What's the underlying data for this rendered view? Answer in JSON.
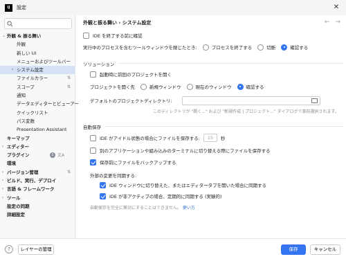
{
  "window": {
    "app_icon_text": "IJ",
    "title": "設定",
    "close_symbol": "✕"
  },
  "sidebar": {
    "search_placeholder": "",
    "items": [
      {
        "label": "外観 & 振る舞い",
        "arrow": "⌄",
        "bold": true
      },
      {
        "label": "外観"
      },
      {
        "label": "新しい UI"
      },
      {
        "label": "メニューおよびツールバー"
      },
      {
        "label": "システム設定",
        "arrow": "›",
        "selected": true
      },
      {
        "label": "ファイルカラー",
        "sync": "⇅"
      },
      {
        "label": "スコープ",
        "sync": "⇅"
      },
      {
        "label": "通知"
      },
      {
        "label": "データエディターとビューアー"
      },
      {
        "label": "クイックリスト"
      },
      {
        "label": "パス変数"
      },
      {
        "label": "Presentation Assistant"
      },
      {
        "label": "キーマップ",
        "bold": true
      },
      {
        "label": "エディター",
        "arrow": "›",
        "bold": true
      },
      {
        "label": "プラグイン",
        "bold": true,
        "badge": "2",
        "trans": "文A"
      },
      {
        "label": "環境",
        "bold": true
      },
      {
        "label": "バージョン管理",
        "arrow": "›",
        "bold": true,
        "sync": "⇅"
      },
      {
        "label": "ビルド、実行、デプロイ",
        "arrow": "›",
        "bold": true
      },
      {
        "label": "言語 & フレームワーク",
        "arrow": "›",
        "bold": true
      },
      {
        "label": "ツール",
        "arrow": "›",
        "bold": true
      },
      {
        "label": "設定の同期",
        "bold": true
      },
      {
        "label": "詳細設定",
        "bold": true
      }
    ]
  },
  "header": {
    "breadcrumb": "外観と振る舞い  ›  システム設定",
    "back": "←",
    "forward": "→"
  },
  "general": {
    "confirm_exit": "IDE を終了する前に確認",
    "process_label": "実行中のプロセスを含むツールウィンドウを閉じたとき:",
    "options": [
      "プロセスを終了する",
      "切断",
      "確認する"
    ],
    "selected": "確認する"
  },
  "project": {
    "section": "ソリューション",
    "reopen": "起動時に前回のプロジェクトを開く",
    "open_label": "プロジェクトを開く先",
    "open_options": [
      "新規ウィンドウ",
      "現在のウィンドウ",
      "確認する"
    ],
    "open_selected": "確認する",
    "dir_label": "デフォルトのプロジェクトディレクトリ:",
    "dir_value": "",
    "dir_hint": "このディレクトリが \"開く...\" および \"新規作成 | プロジェクト...\" ダイアログで事前選択されます。"
  },
  "autosave": {
    "section": "自動保存",
    "idle_label": "IDE がアイドル状態の場合にファイルを保存する:",
    "idle_value": "15",
    "idle_unit": "秒",
    "switch_label": "別のアプリケーションや組み込みのターミナルに切り替える際にファイルを保存する",
    "backup_label": "保存前にファイルをバックアップする",
    "sync_section": "外部の変更を同期する:",
    "sync_switch": "IDE ウィンドウに切り替えた、またはエディタータブを開いた場合に同期する",
    "sync_periodic": "IDE が非アクティブの場合、定期的に同期する (実験的)",
    "note": "自動保存を完全に無効にすることはできません。",
    "note_link": "使い方"
  },
  "footer": {
    "help": "?",
    "layer_button": "レイヤーの管理",
    "save": "保存",
    "cancel": "キャンセル"
  }
}
